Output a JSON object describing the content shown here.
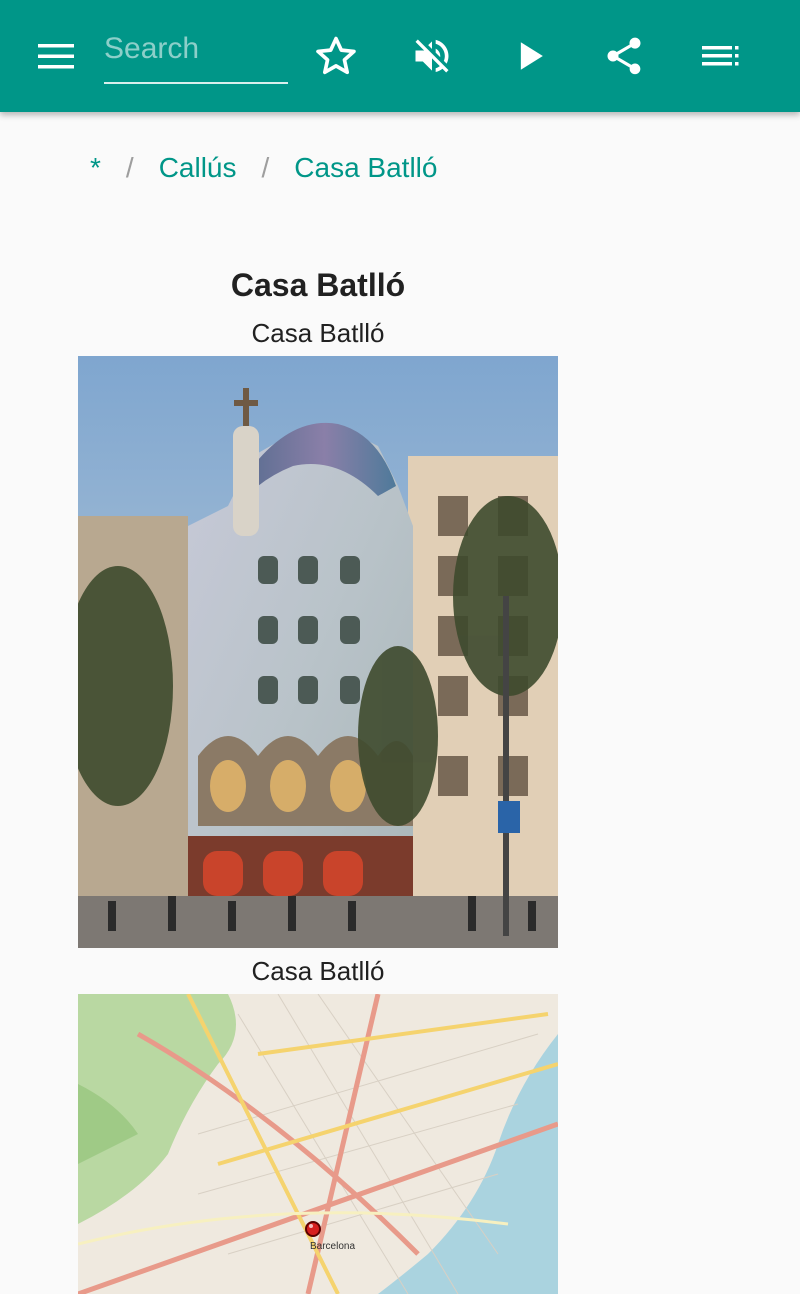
{
  "toolbar": {
    "search_placeholder": "Search",
    "icons": [
      "menu-icon",
      "star-outline-icon",
      "volume-off-icon",
      "play-icon",
      "share-icon",
      "playlist-icon"
    ],
    "accent_color": "#009688"
  },
  "breadcrumb": {
    "items": [
      {
        "label": "*"
      },
      {
        "label": "Callús"
      },
      {
        "label": "Casa Batlló"
      }
    ],
    "separator": "/"
  },
  "article": {
    "title": "Casa Batlló",
    "image_caption": "Casa Batlló",
    "map_caption": "Casa Batlló",
    "map_labels": {
      "city": "Barcelona"
    }
  }
}
